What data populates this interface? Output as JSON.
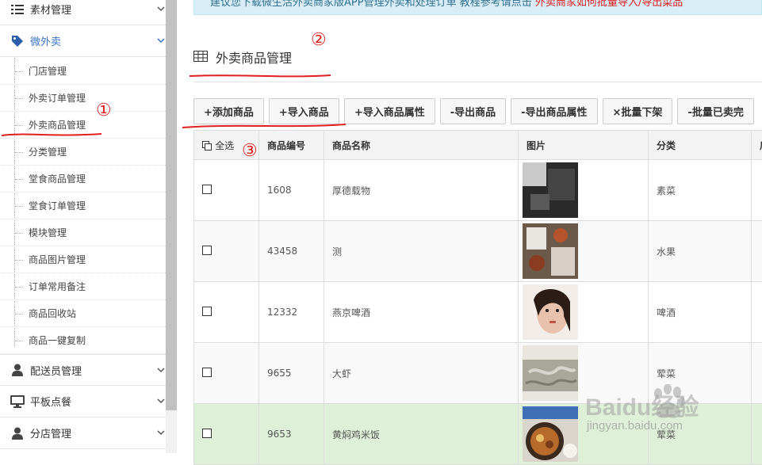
{
  "sidebar": {
    "groups": [
      {
        "label": "素材管理",
        "icon": "list-icon"
      },
      {
        "label": "微外卖",
        "icon": "tag-icon",
        "active": true
      },
      {
        "label": "配送员管理",
        "icon": "user-icon"
      },
      {
        "label": "平板点餐",
        "icon": "monitor-icon"
      },
      {
        "label": "分店管理",
        "icon": "user-icon"
      }
    ],
    "sub_items": [
      "门店管理",
      "外卖订单管理",
      "外卖商品管理",
      "分类管理",
      "堂食商品管理",
      "堂食订单管理",
      "模块管理",
      "商品图片管理",
      "订单常用备注",
      "商品回收站",
      "商品一键复制"
    ]
  },
  "notice": {
    "text": "建议您下载微生活外卖商家版APP管理外卖和处理订单 教程参考请点击 ",
    "link": "外卖商家如何批量导入/导出菜品"
  },
  "page": {
    "title": "外卖商品管理"
  },
  "toolbar": {
    "buttons": [
      "+添加商品",
      "+导入商品",
      "+导入商品属性",
      "-导出商品",
      "-导出商品属性",
      "×批量下架",
      "-批量已卖完"
    ]
  },
  "table": {
    "headers": {
      "select_all": "全选",
      "code": "商品编号",
      "name": "商品名称",
      "image": "图片",
      "category": "分类",
      "extra": "后"
    },
    "rows": [
      {
        "code": "1608",
        "name": "厚德载物",
        "category": "素菜"
      },
      {
        "code": "43458",
        "name": "测",
        "category": "水果"
      },
      {
        "code": "12332",
        "name": "燕京啤酒",
        "category": "啤酒"
      },
      {
        "code": "9655",
        "name": "大虾",
        "category": "荤菜"
      },
      {
        "code": "9653",
        "name": "黄焖鸡米饭",
        "category": "荤菜"
      }
    ]
  },
  "annotations": {
    "a1": "①",
    "a2": "②",
    "a3": "③"
  },
  "watermark": {
    "brand": "Baidu经验",
    "url": "jingyan.baidu.com"
  },
  "colors": {
    "accent": "#3b73c4",
    "annotation": "#e02020",
    "notice_bg": "#d9edf7",
    "highlight_row": "#dff0d8"
  }
}
